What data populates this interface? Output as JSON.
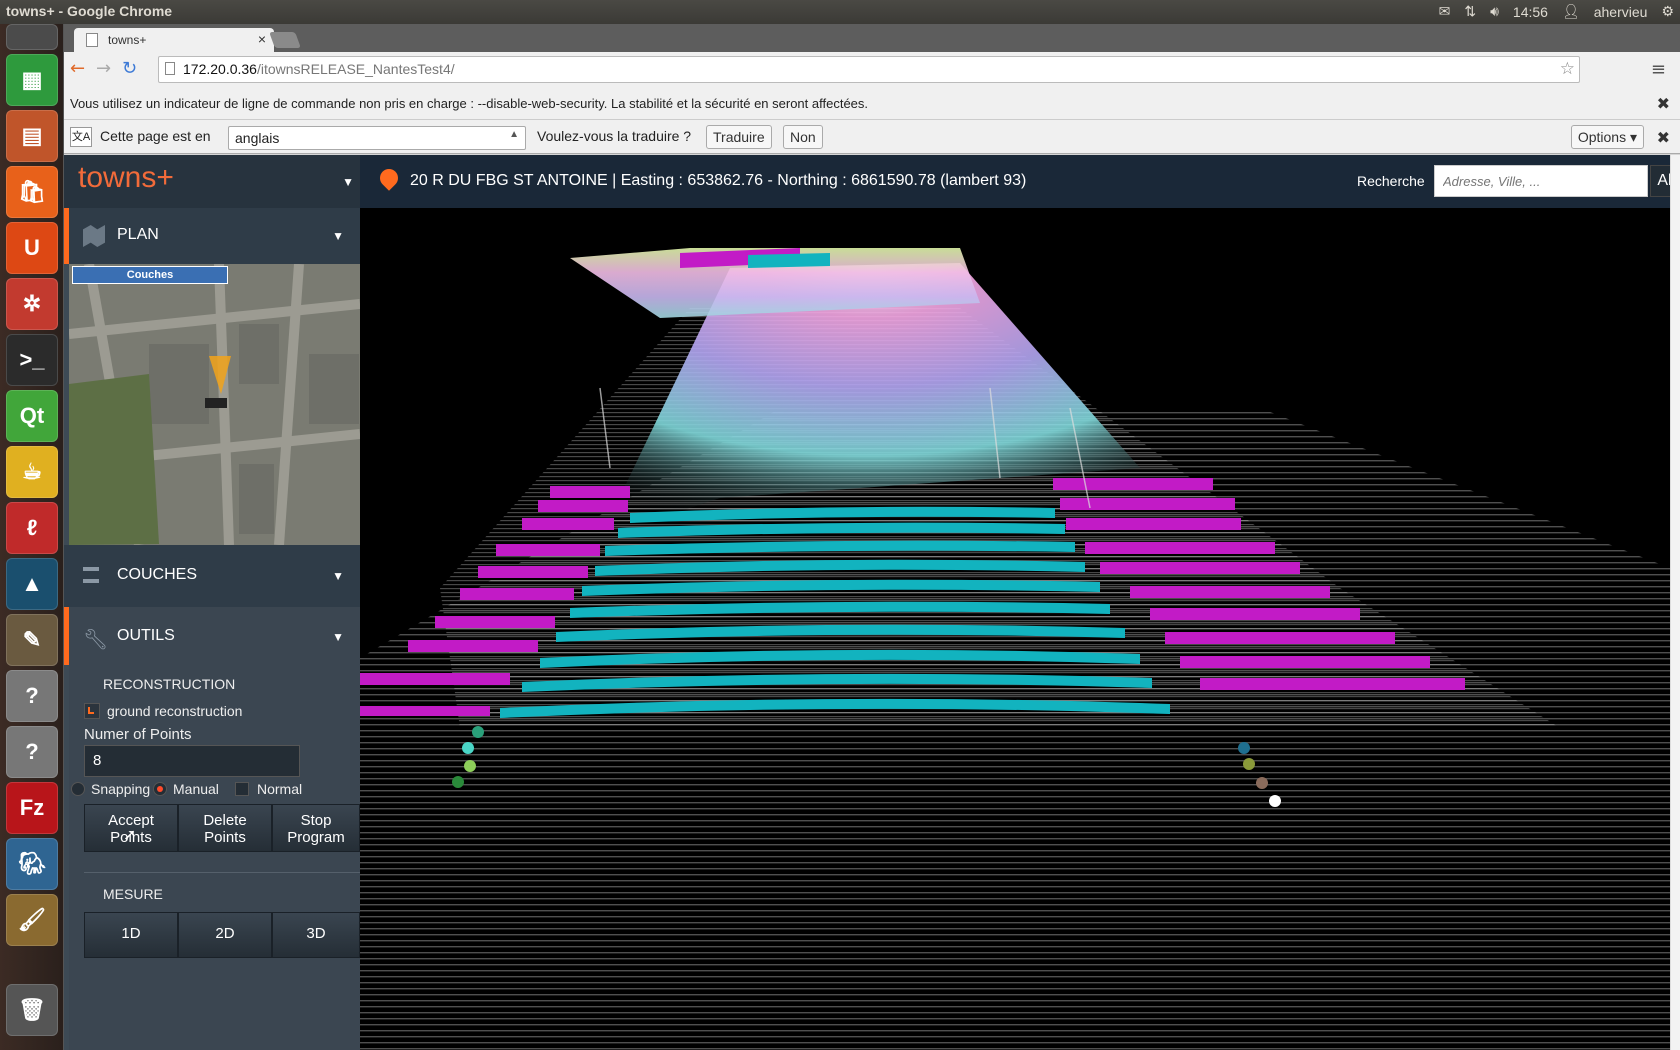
{
  "os": {
    "window_title": "towns+ - Google Chrome",
    "clock": "14:56",
    "user": "ahervieu"
  },
  "browser": {
    "tab_title": "towns+",
    "url_host": "172.20.0.36",
    "url_path": "/itownsRELEASE_NantesTest4/",
    "warning_text": "Vous utilisez un indicateur de ligne de commande non pris en charge : --disable-web-security. La stabilité et la sécurité en seront affectées.",
    "translate_prefix": "Cette page est en",
    "translate_language": "anglais",
    "translate_question": "Voulez-vous la traduire ?",
    "translate_yes": "Traduire",
    "translate_no": "Non",
    "options_label": "Options"
  },
  "app": {
    "logo": "towns+",
    "address_info": "20 R DU FBG ST ANTOINE | Easting : 653862.76 - Northing : 6861590.78 (lambert 93)",
    "search_label": "Recherche",
    "search_placeholder": "Adresse, Ville, ...",
    "search_button": "Aller à",
    "sections": {
      "plan": "PLAN",
      "couches": "COUCHES",
      "outils": "OUTILS"
    },
    "minimap_button": "Couches",
    "reconstruction": {
      "heading": "RECONSTRUCTION",
      "ground_label": "ground reconstruction",
      "num_points_label": "Numer of Points",
      "num_points_value": "8",
      "snapping_label": "Snapping",
      "manual_label": "Manual",
      "normal_label": "Normal",
      "accept_line1": "Accept",
      "accept_line2": "Points",
      "delete_line1": "Delete",
      "delete_line2": "Points",
      "stop_line1": "Stop",
      "stop_line2": "Program"
    },
    "mesure": {
      "heading": "MESURE",
      "btn_1d": "1D",
      "btn_2d": "2D",
      "btn_3d": "3D"
    }
  },
  "colors": {
    "accent": "#ff6a1e",
    "magenta": "#c21bc6",
    "cyan": "#12b3bf"
  }
}
